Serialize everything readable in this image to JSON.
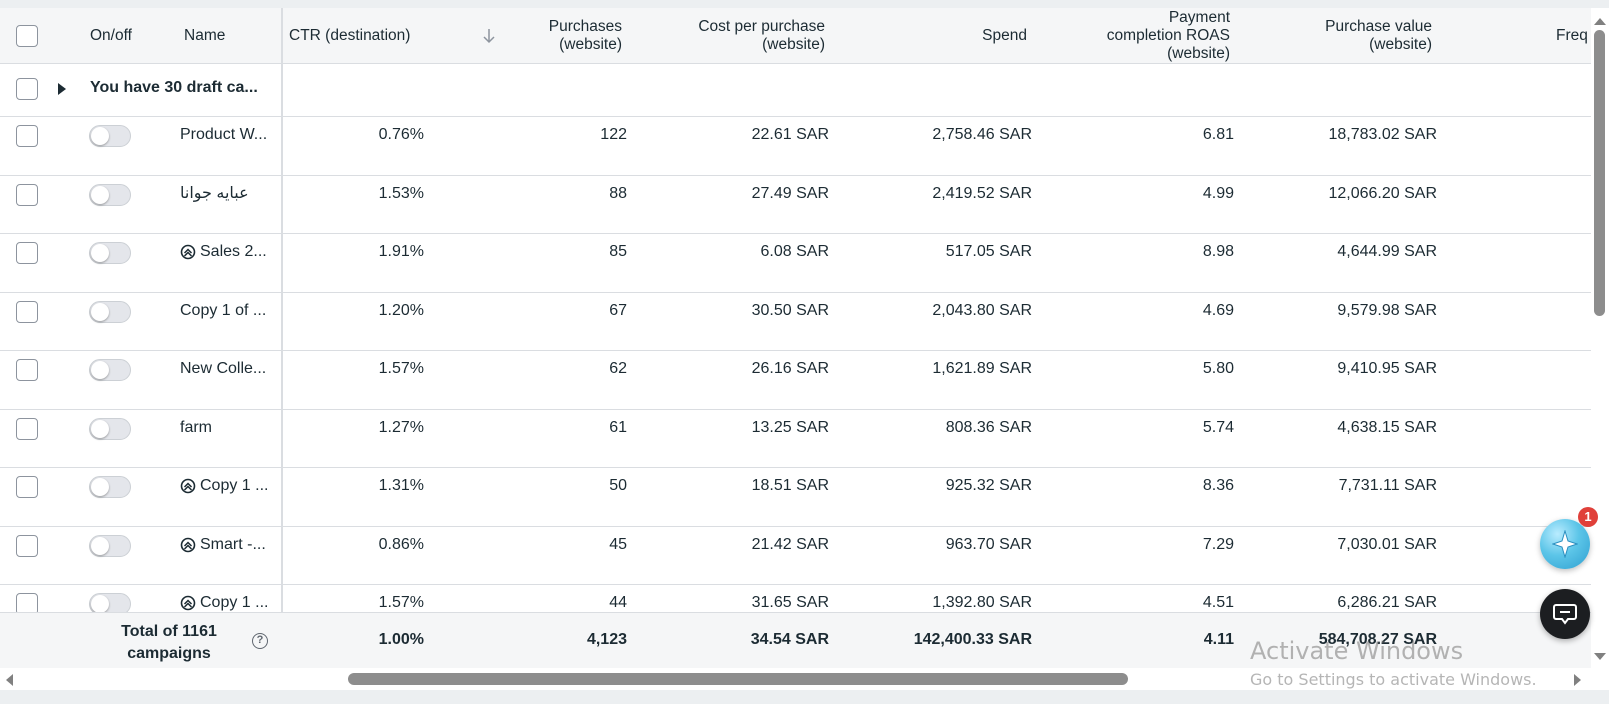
{
  "columns": {
    "onoff": "On/off",
    "name": "Name",
    "ctr_destination": "CTR (destination)",
    "purchases_line1": "Purchases",
    "purchases_line2": "(website)",
    "cost_per_purchase_line1": "Cost per purchase",
    "cost_per_purchase_line2": "(website)",
    "spend": "Spend",
    "roas_line1": "Payment",
    "roas_line2": "completion ROAS",
    "roas_line3": "(website)",
    "purchase_value_line1": "Purchase value",
    "purchase_value_line2": "(website)",
    "frequency_partial": "Freq"
  },
  "sort": {
    "column": "purchases",
    "direction": "descending",
    "icon": "arrow-down-icon"
  },
  "draft_row": {
    "label": "You have 30 draft ca..."
  },
  "rows": [
    {
      "name": "Product W...",
      "advantage_icon": false,
      "ctr": "0.76%",
      "purchases": "122",
      "cost_per_purchase": "22.61 SAR",
      "spend": "2,758.46 SAR",
      "roas": "6.81",
      "purchase_value": "18,783.02 SAR"
    },
    {
      "name": "عبايه جوانا",
      "advantage_icon": false,
      "ctr": "1.53%",
      "purchases": "88",
      "cost_per_purchase": "27.49 SAR",
      "spend": "2,419.52 SAR",
      "roas": "4.99",
      "purchase_value": "12,066.20 SAR"
    },
    {
      "name": "Sales 2...",
      "advantage_icon": true,
      "ctr": "1.91%",
      "purchases": "85",
      "cost_per_purchase": "6.08 SAR",
      "spend": "517.05 SAR",
      "roas": "8.98",
      "purchase_value": "4,644.99 SAR"
    },
    {
      "name": "Copy 1 of ...",
      "advantage_icon": false,
      "ctr": "1.20%",
      "purchases": "67",
      "cost_per_purchase": "30.50 SAR",
      "spend": "2,043.80 SAR",
      "roas": "4.69",
      "purchase_value": "9,579.98 SAR"
    },
    {
      "name": "New Colle...",
      "advantage_icon": false,
      "ctr": "1.57%",
      "purchases": "62",
      "cost_per_purchase": "26.16 SAR",
      "spend": "1,621.89 SAR",
      "roas": "5.80",
      "purchase_value": "9,410.95 SAR"
    },
    {
      "name": "farm",
      "advantage_icon": false,
      "ctr": "1.27%",
      "purchases": "61",
      "cost_per_purchase": "13.25 SAR",
      "spend": "808.36 SAR",
      "roas": "5.74",
      "purchase_value": "4,638.15 SAR"
    },
    {
      "name": "Copy 1 ...",
      "advantage_icon": true,
      "ctr": "1.31%",
      "purchases": "50",
      "cost_per_purchase": "18.51 SAR",
      "spend": "925.32 SAR",
      "roas": "8.36",
      "purchase_value": "7,731.11 SAR"
    },
    {
      "name": "Smart -...",
      "advantage_icon": true,
      "ctr": "0.86%",
      "purchases": "45",
      "cost_per_purchase": "21.42 SAR",
      "spend": "963.70 SAR",
      "roas": "7.29",
      "purchase_value": "7,030.01 SAR"
    },
    {
      "name": "Copy 1 ...",
      "advantage_icon": true,
      "ctr": "1.57%",
      "purchases": "44",
      "cost_per_purchase": "31.65 SAR",
      "spend": "1,392.80 SAR",
      "roas": "4.51",
      "purchase_value": "6,286.21 SAR"
    }
  ],
  "footer": {
    "total_line1": "Total of 1161",
    "total_line2": "campaigns",
    "help": "?",
    "ctr": "1.00%",
    "purchases": "4,123",
    "cost_per_purchase": "34.54 SAR",
    "spend": "142,400.33 SAR",
    "roas": "4.11",
    "purchase_value": "584,708.27 SAR"
  },
  "assistant": {
    "badge_count": "1",
    "icon": "sparkle-star-icon"
  },
  "chat": {
    "icon": "chat-bubble-icon"
  },
  "watermark": {
    "title": "Activate Windows",
    "subtitle": "Go to Settings to activate Windows."
  },
  "colors": {
    "header_bg": "#f5f6f7",
    "border": "#dadde1",
    "text": "#1c2b33",
    "badge": "#e0403a"
  }
}
